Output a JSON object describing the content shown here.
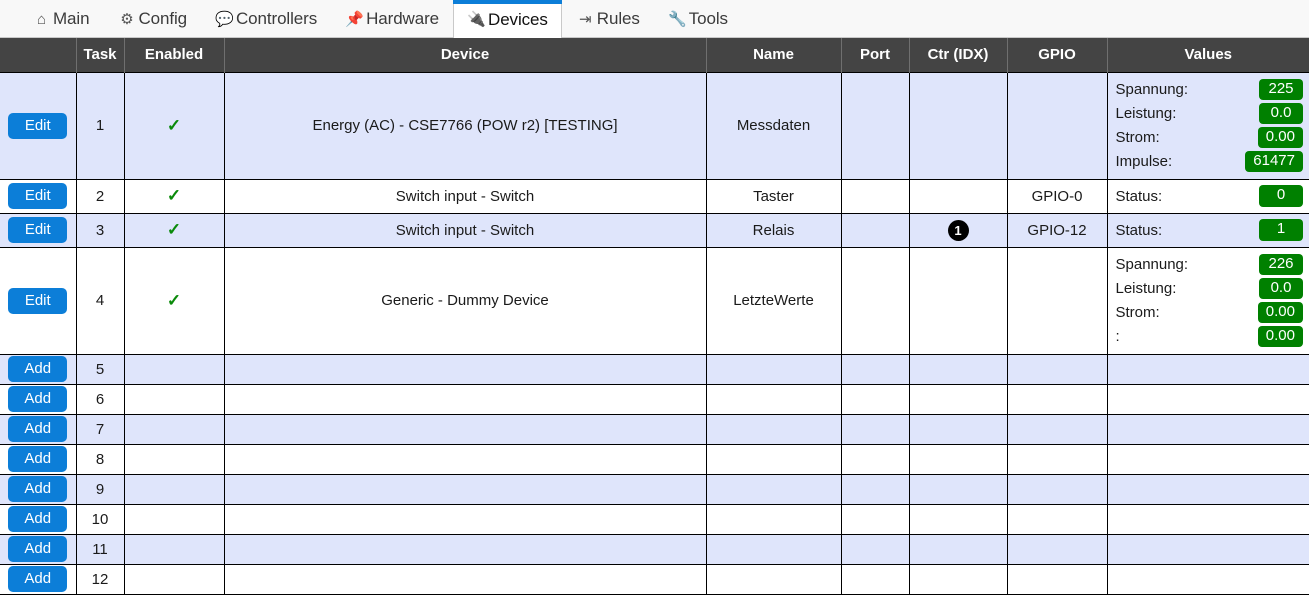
{
  "nav": {
    "tabs": [
      {
        "label": "Main",
        "icon": "home-icon",
        "glyph": "⌂",
        "active": false,
        "color": "#555555"
      },
      {
        "label": "Config",
        "icon": "gear-icon",
        "glyph": "⚙",
        "active": false,
        "color": "#555555"
      },
      {
        "label": "Controllers",
        "icon": "speech-bubble-icon",
        "glyph": "💬",
        "active": false,
        "color": "#555555"
      },
      {
        "label": "Hardware",
        "icon": "pushpin-icon",
        "glyph": "📌",
        "active": false,
        "color": "#e03b1c"
      },
      {
        "label": "Devices",
        "icon": "plug-icon",
        "glyph": "🔌",
        "active": true,
        "color": "#222222"
      },
      {
        "label": "Rules",
        "icon": "arrow-rules-icon",
        "glyph": "⇥",
        "active": false,
        "color": "#555555"
      },
      {
        "label": "Tools",
        "icon": "wrench-icon",
        "glyph": "🔧",
        "active": false,
        "color": "#8a7a5a"
      }
    ]
  },
  "table": {
    "headers": {
      "actions": "",
      "task": "Task",
      "enabled": "Enabled",
      "device": "Device",
      "name": "Name",
      "port": "Port",
      "ctr": "Ctr (IDX)",
      "gpio": "GPIO",
      "values": "Values"
    },
    "edit_label": "Edit",
    "add_label": "Add",
    "enabled_glyph": "✓",
    "rows": [
      {
        "button": "Edit",
        "task": "1",
        "enabled": true,
        "device": "Energy (AC) - CSE7766 (POW r2) [TESTING]",
        "name": "Messdaten",
        "port": "",
        "ctr": "",
        "gpio": "",
        "values": [
          {
            "label": "Spannung:",
            "value": "225"
          },
          {
            "label": "Leistung:",
            "value": "0.0"
          },
          {
            "label": "Strom:",
            "value": "0.00"
          },
          {
            "label": "Impulse:",
            "value": "61477"
          }
        ]
      },
      {
        "button": "Edit",
        "task": "2",
        "enabled": true,
        "device": "Switch input - Switch",
        "name": "Taster",
        "port": "",
        "ctr": "",
        "gpio": "GPIO-0",
        "values": [
          {
            "label": "Status:",
            "value": "0"
          }
        ]
      },
      {
        "button": "Edit",
        "task": "3",
        "enabled": true,
        "device": "Switch input - Switch",
        "name": "Relais",
        "port": "",
        "ctr": "1",
        "gpio": "GPIO-12",
        "values": [
          {
            "label": "Status:",
            "value": "1"
          }
        ]
      },
      {
        "button": "Edit",
        "task": "4",
        "enabled": true,
        "device": "Generic - Dummy Device",
        "name": "LetzteWerte",
        "port": "",
        "ctr": "",
        "gpio": "",
        "values": [
          {
            "label": "Spannung:",
            "value": "226"
          },
          {
            "label": "Leistung:",
            "value": "0.0"
          },
          {
            "label": "Strom:",
            "value": "0.00"
          },
          {
            "label": ":",
            "value": "0.00"
          }
        ]
      },
      {
        "button": "Add",
        "task": "5",
        "enabled": false,
        "device": "",
        "name": "",
        "port": "",
        "ctr": "",
        "gpio": "",
        "values": []
      },
      {
        "button": "Add",
        "task": "6",
        "enabled": false,
        "device": "",
        "name": "",
        "port": "",
        "ctr": "",
        "gpio": "",
        "values": []
      },
      {
        "button": "Add",
        "task": "7",
        "enabled": false,
        "device": "",
        "name": "",
        "port": "",
        "ctr": "",
        "gpio": "",
        "values": []
      },
      {
        "button": "Add",
        "task": "8",
        "enabled": false,
        "device": "",
        "name": "",
        "port": "",
        "ctr": "",
        "gpio": "",
        "values": []
      },
      {
        "button": "Add",
        "task": "9",
        "enabled": false,
        "device": "",
        "name": "",
        "port": "",
        "ctr": "",
        "gpio": "",
        "values": []
      },
      {
        "button": "Add",
        "task": "10",
        "enabled": false,
        "device": "",
        "name": "",
        "port": "",
        "ctr": "",
        "gpio": "",
        "values": []
      },
      {
        "button": "Add",
        "task": "11",
        "enabled": false,
        "device": "",
        "name": "",
        "port": "",
        "ctr": "",
        "gpio": "",
        "values": []
      },
      {
        "button": "Add",
        "task": "12",
        "enabled": false,
        "device": "",
        "name": "",
        "port": "",
        "ctr": "",
        "gpio": "",
        "values": []
      }
    ]
  },
  "colors": {
    "accent_blue": "#0c7ed8",
    "header_gray": "#444444",
    "row_odd": "#dfe5fb",
    "row_even": "#ffffff",
    "badge_green": "#008000",
    "check_green": "#0a8a0a"
  }
}
